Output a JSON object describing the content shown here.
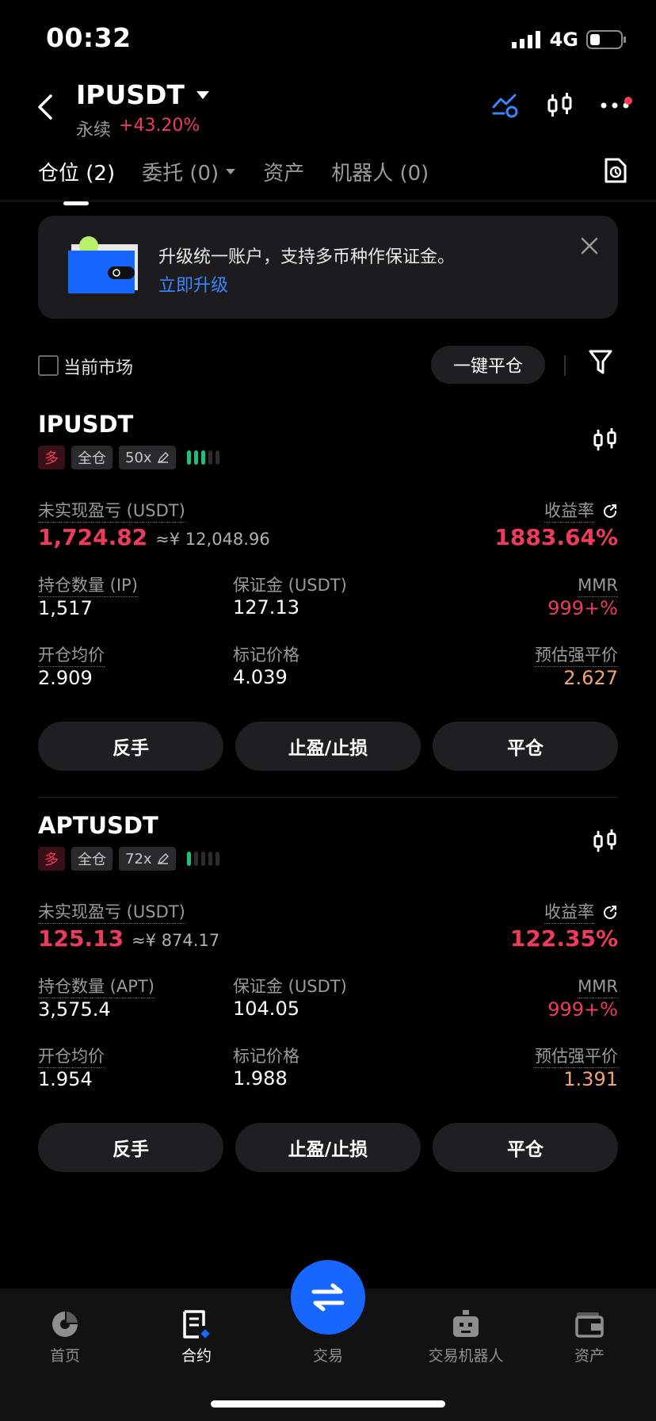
{
  "status_bar": {
    "time": "00:32",
    "network": "4G"
  },
  "header": {
    "symbol": "IPUSDT",
    "contract_type": "永续",
    "change": "+43.20%"
  },
  "tabs": [
    {
      "label": "仓位 (2)"
    },
    {
      "label": "委托 (0)"
    },
    {
      "label": "资产"
    },
    {
      "label": "机器人 (0)"
    }
  ],
  "banner": {
    "text": "升级统一账户，支持多币种作保证金。",
    "link": "立即升级"
  },
  "filter": {
    "current_market_label": "当前市场",
    "close_all_label": "一键平仓"
  },
  "positions": [
    {
      "symbol": "IPUSDT",
      "side": "多",
      "margin_mode": "全仓",
      "leverage": "50x",
      "risk_level": 3,
      "pnl_label": "未实现盈亏 (USDT)",
      "pnl_value": "1,724.82",
      "pnl_cny": "≈¥ 12,048.96",
      "roe_label": "收益率",
      "roe_value": "1883.64%",
      "qty_label": "持仓数量 (IP)",
      "qty_value": "1,517",
      "margin_label": "保证金 (USDT)",
      "margin_value": "127.13",
      "mmr_label": "MMR",
      "mmr_value": "999+%",
      "entry_label": "开仓均价",
      "entry_value": "2.909",
      "mark_label": "标记价格",
      "mark_value": "4.039",
      "liq_label": "预估强平价",
      "liq_value": "2.627",
      "btn_reverse": "反手",
      "btn_tpsl": "止盈/止损",
      "btn_close": "平仓"
    },
    {
      "symbol": "APTUSDT",
      "side": "多",
      "margin_mode": "全仓",
      "leverage": "72x",
      "risk_level": 1,
      "pnl_label": "未实现盈亏 (USDT)",
      "pnl_value": "125.13",
      "pnl_cny": "≈¥ 874.17",
      "roe_label": "收益率",
      "roe_value": "122.35%",
      "qty_label": "持仓数量 (APT)",
      "qty_value": "3,575.4",
      "margin_label": "保证金 (USDT)",
      "margin_value": "104.05",
      "mmr_label": "MMR",
      "mmr_value": "999+%",
      "entry_label": "开仓均价",
      "entry_value": "1.954",
      "mark_label": "标记价格",
      "mark_value": "1.988",
      "liq_label": "预估强平价",
      "liq_value": "1.391",
      "btn_reverse": "反手",
      "btn_tpsl": "止盈/止损",
      "btn_close": "平仓"
    }
  ],
  "bottom_nav": [
    {
      "label": "首页",
      "icon": "home-icon"
    },
    {
      "label": "合约",
      "icon": "contract-icon"
    },
    {
      "label": "交易",
      "icon": "swap-icon"
    },
    {
      "label": "交易机器人",
      "icon": "robot-icon"
    },
    {
      "label": "资产",
      "icon": "wallet-icon"
    }
  ],
  "colors": {
    "accent": "#1767ff",
    "loss_profit_red": "#ee3b5b",
    "liquidation_orange": "#f4a56c",
    "long_green": "#19c37d"
  }
}
